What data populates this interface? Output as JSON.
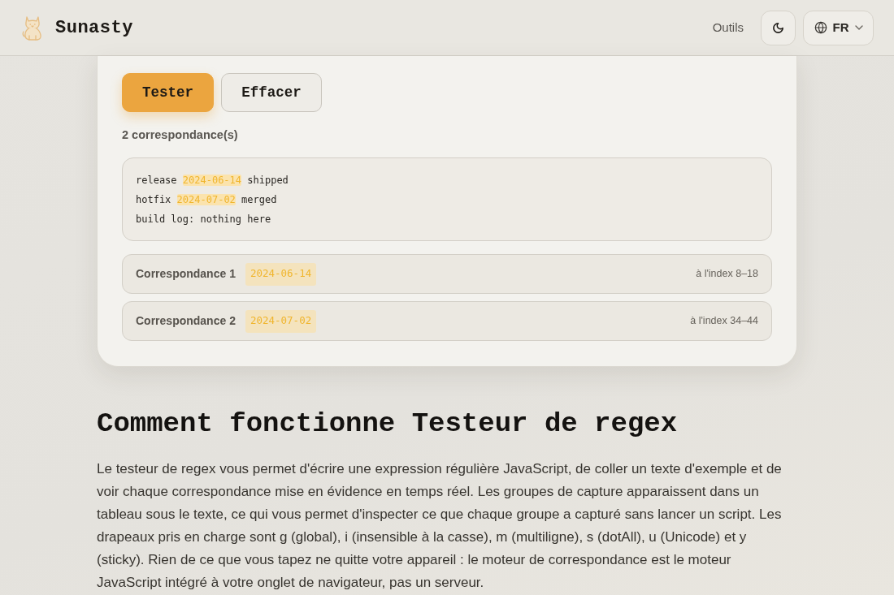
{
  "header": {
    "brand": "Sunasty",
    "nav": [
      {
        "label": "Outils"
      }
    ],
    "language": {
      "label": "FR"
    }
  },
  "tester": {
    "buttons": [
      {
        "label": "Tester",
        "kind": "primary"
      },
      {
        "label": "Effacer",
        "kind": "secondary"
      }
    ],
    "match_count": "2 correspondance(s)",
    "sample_text": [
      [
        {
          "text": "release ",
          "highlighted": false
        },
        {
          "text": "2024-06-14",
          "highlighted": true
        },
        {
          "text": " shipped",
          "highlighted": false
        }
      ],
      [
        {
          "text": "hotfix ",
          "highlighted": false
        },
        {
          "text": "2024-07-02",
          "highlighted": true
        },
        {
          "text": " merged",
          "highlighted": false
        }
      ],
      [
        {
          "text": "build log: nothing here",
          "highlighted": false
        }
      ]
    ],
    "matches": [
      {
        "label": "Correspondance 1",
        "value": "2024-06-14",
        "position": "à l'index 8–18"
      },
      {
        "label": "Correspondance 2",
        "value": "2024-07-02",
        "position": "à l'index 34–44"
      }
    ]
  },
  "article": {
    "heading": "Comment fonctionne Testeur de regex",
    "paragraph": "Le testeur de regex vous permet d'écrire une expression régulière JavaScript, de coller un texte d'exemple et de voir chaque correspondance mise en évidence en temps réel. Les groupes de capture apparaissent dans un tableau sous le texte, ce qui vous permet d'inspecter ce que chaque groupe a capturé sans lancer un script. Les drapeaux pris en charge sont g (global), i (insensible à la casse), m (multiligne), s (dotAll), u (Unicode) et y (sticky). Rien de ce que vous tapez ne quitte votre appareil : le moteur de correspondance est le moteur JavaScript intégré à votre onglet de navigateur, pas un serveur."
  }
}
